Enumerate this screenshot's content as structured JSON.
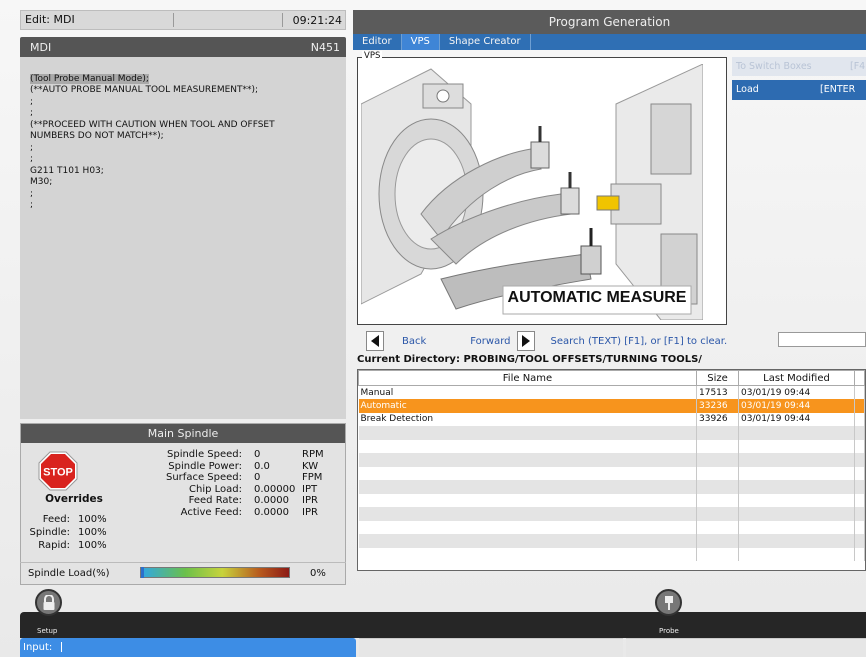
{
  "left": {
    "mode_title": "Edit: MDI",
    "clock": "09:21:24",
    "mdi": {
      "title": "MDI",
      "block": "N451",
      "lines": [
        "(Tool Probe Manual Mode);",
        "(**AUTO PROBE MANUAL TOOL MEASUREMENT**);",
        ";",
        ";",
        "(**PROCEED WITH CAUTION WHEN TOOL AND OFFSET",
        "NUMBERS DO NOT MATCH**);",
        ";",
        ";",
        "G211 T101 H03;",
        "M30;",
        ";",
        ";"
      ]
    },
    "spindle": {
      "title": "Main Spindle",
      "stop_label": "STOP",
      "overrides_title": "Overrides",
      "overrides": [
        {
          "label": "Feed:",
          "value": "100%"
        },
        {
          "label": "Spindle:",
          "value": "100%"
        },
        {
          "label": "Rapid:",
          "value": "100%"
        }
      ],
      "stats": [
        {
          "label": "Spindle Speed:",
          "value": "0",
          "unit": "RPM"
        },
        {
          "label": "Spindle Power:",
          "value": "0.0",
          "unit": "KW"
        },
        {
          "label": "Surface Speed:",
          "value": "0",
          "unit": "FPM"
        },
        {
          "label": "Chip Load:",
          "value": "0.00000",
          "unit": "IPT"
        },
        {
          "label": "Feed Rate:",
          "value": "0.0000",
          "unit": "IPR"
        },
        {
          "label": "Active Feed:",
          "value": "0.0000",
          "unit": "IPR"
        }
      ],
      "load_label": "Spindle Load(%)",
      "load_value": "0%",
      "load_fraction": 0
    }
  },
  "right": {
    "title": "Program Generation",
    "tabs": [
      "Editor",
      "VPS",
      "Shape Creator"
    ],
    "active_tab": "VPS",
    "vps_label": "VPS",
    "image_caption": "AUTOMATIC MEASURE",
    "switch_boxes": "To Switch Boxes",
    "switch_boxes_key": "[F4",
    "load_label": "Load",
    "load_key": "[ENTER",
    "nav": {
      "back": "Back",
      "forward": "Forward",
      "search_hint": "Search (TEXT) [F1], or [F1] to clear."
    },
    "current_directory_label": "Current Directory:",
    "current_directory": "PROBING/TOOL OFFSETS/TURNING TOOLS/",
    "table": {
      "headers": [
        "File Name",
        "Size",
        "Last Modified"
      ],
      "rows": [
        {
          "name": "Manual",
          "size": "17513",
          "modified": "03/01/19 09:44"
        },
        {
          "name": "Automatic",
          "size": "33236",
          "modified": "03/01/19 09:44"
        },
        {
          "name": "Break Detection",
          "size": "33926",
          "modified": "03/01/19 09:44"
        }
      ],
      "selected_index": 1
    }
  },
  "bottom": {
    "setup_label": "Setup",
    "probe_label": "Probe",
    "input_label": "Input:"
  },
  "colors": {
    "accent_blue": "#2f6fb4",
    "selection_orange": "#f7941d",
    "header_grey": "#555555",
    "stop_red": "#d9231e"
  }
}
